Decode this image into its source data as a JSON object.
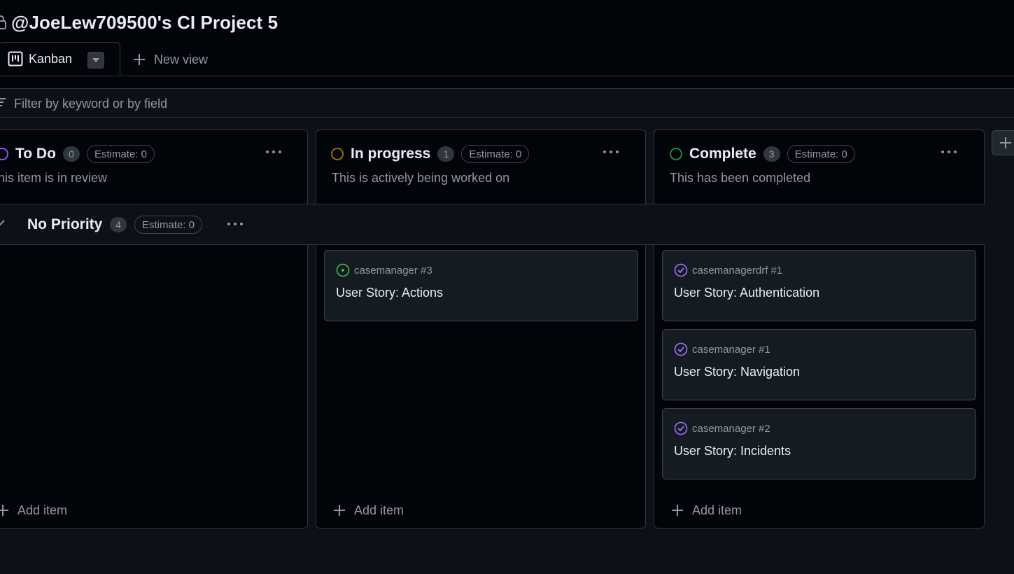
{
  "project": {
    "title": "@JoeLew709500's CI Project 5"
  },
  "views": {
    "active_tab": {
      "label": "Kanban"
    },
    "new_view_label": "New view"
  },
  "filter": {
    "placeholder": "Filter by keyword or by field",
    "value": ""
  },
  "columns": [
    {
      "name": "To Do",
      "count": "0",
      "estimate": "Estimate: 0",
      "description": "This item is in review",
      "status_color": "#8957e5",
      "add_item_label": "Add item"
    },
    {
      "name": "In progress",
      "count": "1",
      "estimate": "Estimate: 0",
      "description": "This is actively being worked on",
      "status_color": "#9e6a03",
      "add_item_label": "Add item"
    },
    {
      "name": "Complete",
      "count": "3",
      "estimate": "Estimate: 0",
      "description": "This has been completed",
      "status_color": "#238636",
      "add_item_label": "Add item"
    }
  ],
  "group": {
    "name": "No Priority",
    "count": "4",
    "estimate": "Estimate: 0"
  },
  "cards": {
    "in_progress": [
      {
        "ref": "casemanager #3",
        "title": "User Story: Actions",
        "state": "open",
        "icon": "issue-open-icon"
      }
    ],
    "complete": [
      {
        "ref": "casemanagerdrf #1",
        "title": "User Story: Authentication",
        "state": "closed",
        "icon": "issue-closed-icon"
      },
      {
        "ref": "casemanager #1",
        "title": "User Story: Navigation",
        "state": "closed",
        "icon": "issue-closed-icon"
      },
      {
        "ref": "casemanager #2",
        "title": "User Story: Incidents",
        "state": "closed",
        "icon": "issue-closed-icon"
      }
    ]
  },
  "colors": {
    "background": "#010409",
    "panel": "#0d1117",
    "card": "#151b23",
    "border": "#30363d",
    "open": "#3fb950",
    "closed": "#a371f7",
    "muted": "#9198a1",
    "text": "#e6edf3"
  }
}
